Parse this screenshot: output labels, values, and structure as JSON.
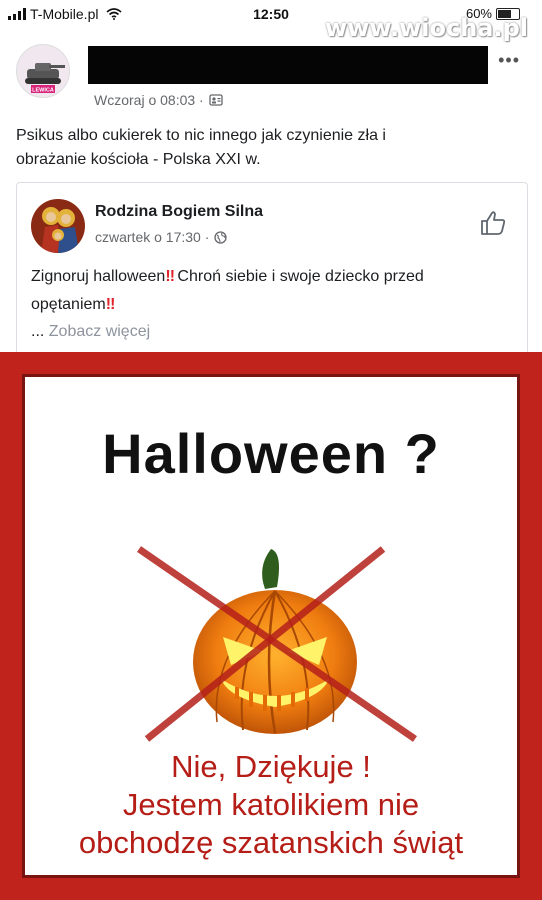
{
  "status_bar": {
    "carrier": "T-Mobile.pl",
    "time": "12:50",
    "battery": "60%"
  },
  "watermark": "www.wiocha.pl",
  "post": {
    "timestamp": "Wczoraj o 08:03 ·",
    "text_line1": "Psikus albo cukierek to nic innego jak czynienie zła i",
    "text_line2": "obrażanie kościoła - Polska XXI w.",
    "avatar_badge": "LEWICA"
  },
  "shared": {
    "page_name": "Rodzina Bogiem Silna",
    "timestamp": "czwartek o 17:30 ·",
    "text_part1": "Zignoruj halloween",
    "exclaim": "‼",
    "text_part2": " Chroń siebie i swoje dziecko przed",
    "text_part3": "opętaniem",
    "see_more_prefix": "... ",
    "see_more": "Zobacz więcej"
  },
  "poster": {
    "title": "Halloween ?",
    "line1": "Nie, Dziękuje !",
    "line2": "Jestem katolikiem nie",
    "line3": "obchodzę szatanskich świąt"
  },
  "colors": {
    "poster_red": "#c0231c",
    "text_red": "#b51d17",
    "fb_gray": "#65676b"
  }
}
